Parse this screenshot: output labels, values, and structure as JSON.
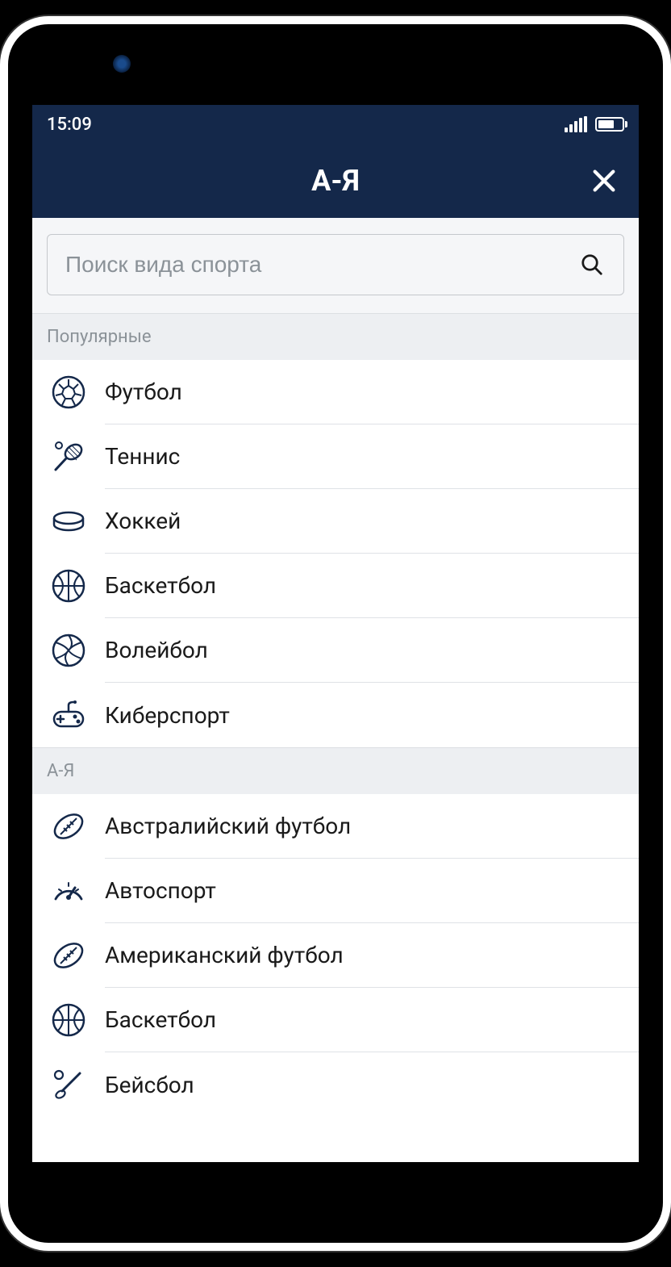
{
  "status": {
    "time": "15:09"
  },
  "header": {
    "title": "А-Я"
  },
  "search": {
    "placeholder": "Поиск вида спорта"
  },
  "sections": {
    "popular": {
      "title": "Популярные",
      "items": [
        {
          "label": "Футбол",
          "icon": "soccer"
        },
        {
          "label": "Теннис",
          "icon": "tennis"
        },
        {
          "label": "Хоккей",
          "icon": "hockey"
        },
        {
          "label": "Баскетбол",
          "icon": "basketball"
        },
        {
          "label": "Волейбол",
          "icon": "volleyball"
        },
        {
          "label": "Киберспорт",
          "icon": "esports"
        }
      ]
    },
    "az": {
      "title": "А-Я",
      "items": [
        {
          "label": "Австралийский футбол",
          "icon": "aussie"
        },
        {
          "label": "Автоспорт",
          "icon": "motorsport"
        },
        {
          "label": "Американский футбол",
          "icon": "amfootball"
        },
        {
          "label": "Баскетбол",
          "icon": "basketball"
        },
        {
          "label": "Бейсбол",
          "icon": "baseball"
        }
      ]
    }
  },
  "colors": {
    "header_bg": "#14284a",
    "icon_stroke": "#14284a",
    "section_bg": "#edeff2",
    "divider": "#dfe2e6"
  }
}
